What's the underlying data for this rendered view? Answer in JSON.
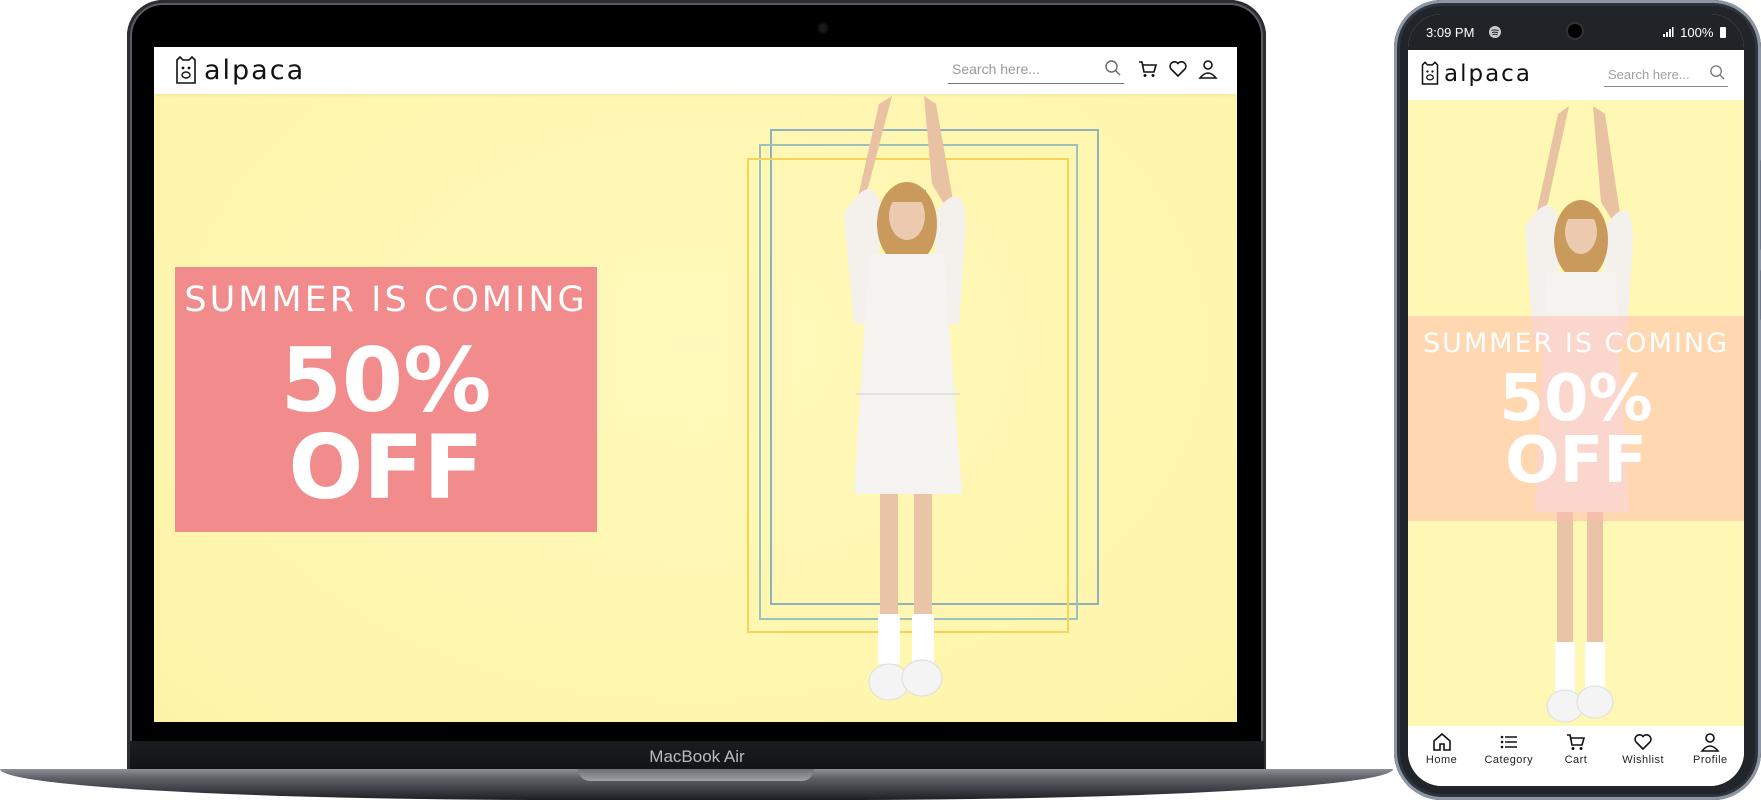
{
  "laptop": {
    "brand_label": "MacBook Air",
    "nav": {
      "logo_text": "alpaca",
      "search_placeholder": "Search here...",
      "icons": [
        "search-icon",
        "cart-icon",
        "heart-icon",
        "user-icon"
      ]
    },
    "hero": {
      "promo_subtitle": "SUMMER IS COMING",
      "promo_line1": "50%",
      "promo_line2": "OFF",
      "colors": {
        "background": "#fff7b4",
        "promo_box": "#f28b8c",
        "frame_blue": "#8fb0bd",
        "frame_teal": "#9cc3bb",
        "frame_yellow": "#f7d35a"
      }
    }
  },
  "phone": {
    "status": {
      "time": "3:09 PM",
      "battery": "100%"
    },
    "nav": {
      "logo_text": "alpaca",
      "search_placeholder": "Search here..."
    },
    "hero": {
      "promo_subtitle": "SUMMER IS COMING",
      "promo_line1": "50%",
      "promo_line2": "OFF"
    },
    "tabbar": [
      {
        "label": "Home",
        "icon": "home-icon"
      },
      {
        "label": "Category",
        "icon": "list-icon"
      },
      {
        "label": "Cart",
        "icon": "cart-icon"
      },
      {
        "label": "Wishlist",
        "icon": "heart-icon"
      },
      {
        "label": "Profile",
        "icon": "user-icon"
      }
    ]
  }
}
